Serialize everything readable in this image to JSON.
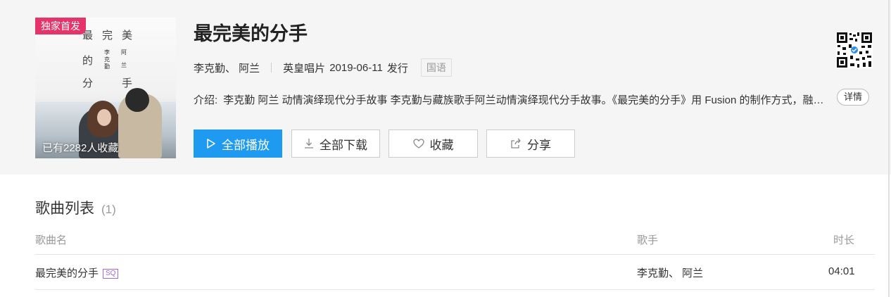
{
  "album": {
    "cover_tag": "独家首发",
    "cover_fav_text": "已有2282人收藏",
    "cover_chars": [
      "最",
      "完",
      "美",
      "的",
      "分",
      "手"
    ],
    "cover_small_chars": [
      "李",
      "克",
      "勤",
      "阿",
      "兰"
    ],
    "title": "最完美的分手",
    "artists": "李克勤、 阿兰",
    "label": "英皇唱片",
    "release_date": "2019-06-11",
    "release_suffix": "发行",
    "language": "国语",
    "intro_label": "介绍:",
    "intro_text": "李克勤 阿兰 动情演绎现代分手故事 李克勤与藏族歌手阿兰动情演绎现代分手故事。《最完美的分手》用 Fusion 的制作方式，融合了多种音乐元素",
    "detail_label": "详情"
  },
  "actions": {
    "play_all": "全部播放",
    "download_all": "全部下载",
    "favorite": "收藏",
    "share": "分享"
  },
  "song_list": {
    "title": "歌曲列表",
    "count": "(1)",
    "columns": {
      "name": "歌曲名",
      "singer": "歌手",
      "duration": "时长"
    },
    "rows": [
      {
        "name": "最完美的分手",
        "badge": "SQ",
        "singer": "李克勤、 阿兰",
        "duration": "04:01"
      }
    ]
  },
  "icons": {
    "play": "play-outline-icon",
    "download": "download-icon",
    "favorite": "heart-outline-icon",
    "share": "share-icon",
    "qr": "qr-code-icon"
  },
  "colors": {
    "accent_blue": "#1e9bf0",
    "tag_pink": "#e5346c",
    "sq_purple": "#9b6bdc",
    "header_bg": "#f5f5f5"
  }
}
